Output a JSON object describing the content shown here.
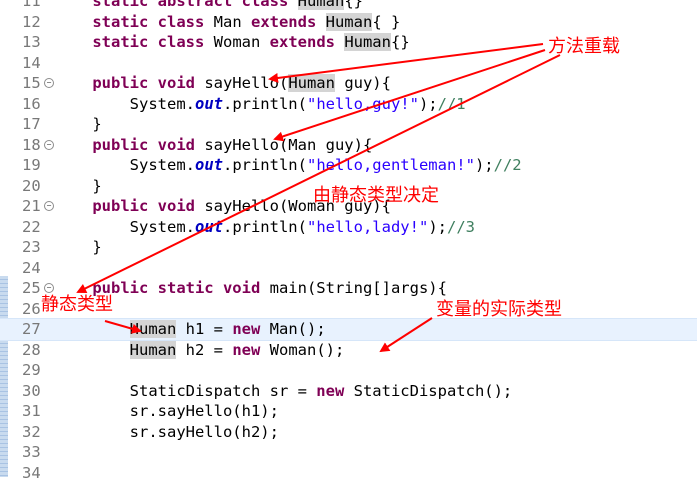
{
  "editor": {
    "lines": [
      {
        "n": "11",
        "parts": [
          [
            "i",
            "    "
          ],
          [
            "kw",
            "static abstract class "
          ],
          [
            "mark",
            "Human"
          ],
          [
            "t",
            "{}"
          ]
        ]
      },
      {
        "n": "12",
        "parts": [
          [
            "i",
            "    "
          ],
          [
            "kw",
            "static class "
          ],
          [
            "t",
            "Man "
          ],
          [
            "kw",
            "extends "
          ],
          [
            "mark",
            "Human"
          ],
          [
            "t",
            "{ }"
          ]
        ]
      },
      {
        "n": "13",
        "parts": [
          [
            "i",
            "    "
          ],
          [
            "kw",
            "static class "
          ],
          [
            "t",
            "Woman "
          ],
          [
            "kw",
            "extends "
          ],
          [
            "mark",
            "Human"
          ],
          [
            "t",
            "{}"
          ]
        ]
      },
      {
        "n": "14",
        "parts": []
      },
      {
        "n": "15",
        "fold": true,
        "parts": [
          [
            "i",
            "    "
          ],
          [
            "kw",
            "public void "
          ],
          [
            "t",
            "sayHello("
          ],
          [
            "mark",
            "Human"
          ],
          [
            "t",
            " guy){"
          ]
        ]
      },
      {
        "n": "16",
        "parts": [
          [
            "i",
            "        "
          ],
          [
            "t",
            "System."
          ],
          [
            "field",
            "out"
          ],
          [
            "t",
            ".println("
          ],
          [
            "str",
            "\"hello,guy!\""
          ],
          [
            "t",
            ");"
          ],
          [
            "cm",
            "//1"
          ]
        ]
      },
      {
        "n": "17",
        "parts": [
          [
            "i",
            "    "
          ],
          [
            "t",
            "}"
          ]
        ]
      },
      {
        "n": "18",
        "fold": true,
        "parts": [
          [
            "i",
            "    "
          ],
          [
            "kw",
            "public void "
          ],
          [
            "t",
            "sayHello(Man guy){"
          ]
        ]
      },
      {
        "n": "19",
        "parts": [
          [
            "i",
            "        "
          ],
          [
            "t",
            "System."
          ],
          [
            "field",
            "out"
          ],
          [
            "t",
            ".println("
          ],
          [
            "str",
            "\"hello,gentleman!\""
          ],
          [
            "t",
            ");"
          ],
          [
            "cm",
            "//2"
          ]
        ]
      },
      {
        "n": "20",
        "parts": [
          [
            "i",
            "    "
          ],
          [
            "t",
            "}"
          ]
        ]
      },
      {
        "n": "21",
        "fold": true,
        "parts": [
          [
            "i",
            "    "
          ],
          [
            "kw",
            "public void "
          ],
          [
            "t",
            "sayHello(Woman guy){"
          ]
        ]
      },
      {
        "n": "22",
        "parts": [
          [
            "i",
            "        "
          ],
          [
            "t",
            "System."
          ],
          [
            "field",
            "out"
          ],
          [
            "t",
            ".println("
          ],
          [
            "str",
            "\"hello,lady!\""
          ],
          [
            "t",
            ");"
          ],
          [
            "cm",
            "//3"
          ]
        ]
      },
      {
        "n": "23",
        "parts": [
          [
            "i",
            "    "
          ],
          [
            "t",
            "}"
          ]
        ]
      },
      {
        "n": "24",
        "parts": []
      },
      {
        "n": "25",
        "fold": true,
        "parts": [
          [
            "i",
            "    "
          ],
          [
            "kw",
            "public static void "
          ],
          [
            "t",
            "main(String[]args){"
          ]
        ]
      },
      {
        "n": "26",
        "parts": []
      },
      {
        "n": "27",
        "hl": true,
        "parts": [
          [
            "i",
            "        "
          ],
          [
            "mark",
            "Human"
          ],
          [
            "t",
            " h1 = "
          ],
          [
            "kw",
            "new "
          ],
          [
            "t",
            "Man();"
          ]
        ]
      },
      {
        "n": "28",
        "parts": [
          [
            "i",
            "        "
          ],
          [
            "mark",
            "Human"
          ],
          [
            "t",
            " h2 = "
          ],
          [
            "kw",
            "new "
          ],
          [
            "t",
            "Woman();"
          ]
        ]
      },
      {
        "n": "29",
        "parts": []
      },
      {
        "n": "30",
        "parts": [
          [
            "i",
            "        "
          ],
          [
            "t",
            "StaticDispatch sr = "
          ],
          [
            "kw",
            "new "
          ],
          [
            "t",
            "StaticDispatch();"
          ]
        ]
      },
      {
        "n": "31",
        "parts": [
          [
            "i",
            "        "
          ],
          [
            "t",
            "sr.sayHello(h1);"
          ]
        ]
      },
      {
        "n": "32",
        "parts": [
          [
            "i",
            "        "
          ],
          [
            "t",
            "sr.sayHello(h2);"
          ]
        ]
      },
      {
        "n": "33",
        "parts": []
      },
      {
        "n": "34",
        "parts": []
      }
    ]
  },
  "annotations": {
    "overload": "方法重载",
    "static_decided": "由静态类型决定",
    "static_type": "静态类型",
    "actual_type": "变量的实际类型"
  },
  "colors": {
    "keyword": "#7f0055",
    "string": "#2a00ff",
    "comment": "#3f7f5f",
    "annotation": "#ff0000",
    "current_line": "#e8f2fe"
  }
}
